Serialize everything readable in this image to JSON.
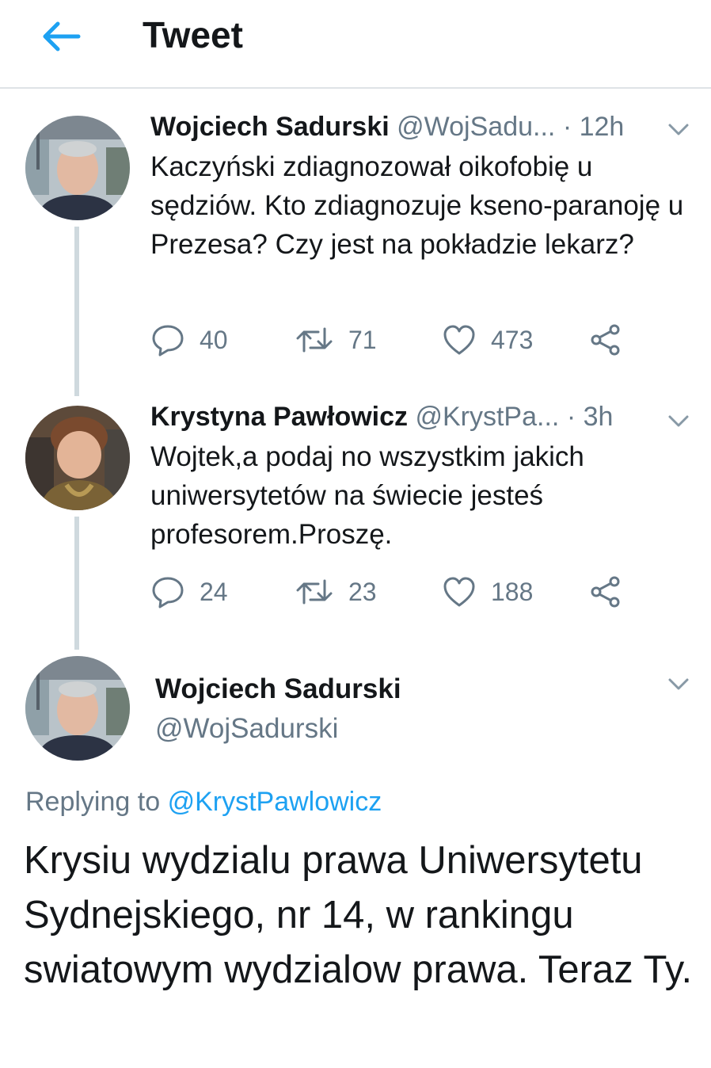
{
  "header": {
    "title": "Tweet",
    "back_icon": "arrow-left-icon",
    "accent": "#1da1f2"
  },
  "colors": {
    "text": "#14171a",
    "secondary": "#657786",
    "link": "#1da1f2",
    "thread_line": "#cfd9de"
  },
  "thread": [
    {
      "name": "Wojciech Sadurski",
      "handle": "@WojSadu...",
      "time": "· 12h",
      "text": "Kaczyński zdiagnozował oikofobię u sędziów. Kto zdiagnozuje kseno-paranoję u Prezesa? Czy jest na pokładzie lekarz?",
      "replies": "40",
      "retweets": "71",
      "likes": "473"
    },
    {
      "name": "Krystyna Pawłowicz",
      "handle": "@KrystPa...",
      "time": "· 3h",
      "text": "Wojtek,a podaj no wszystkim jakich uniwersytetów na świecie jesteś profesorem.Proszę.",
      "replies": "24",
      "retweets": "23",
      "likes": "188"
    }
  ],
  "main_tweet": {
    "name": "Wojciech Sadurski",
    "handle": "@WojSadurski",
    "replying_prefix": "Replying to",
    "replying_to": "@KrystPawlowicz",
    "text": "Krysiu wydzialu prawa Uniwersytetu Sydnejskiego, nr 14, w rankingu swiatowym wydzialow prawa. Teraz Ty."
  }
}
